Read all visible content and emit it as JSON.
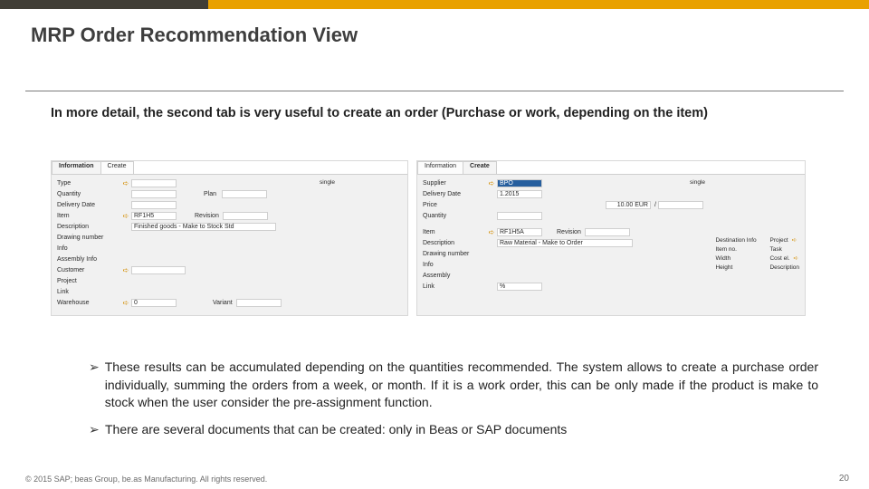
{
  "title": "MRP Order Recommendation View",
  "intro": "In more detail, the second tab is very useful to create an order (Purchase or work, depending on the item)",
  "paneA": {
    "tabs": [
      {
        "label": "Information",
        "active": true
      },
      {
        "label": "Create",
        "active": false
      }
    ],
    "single": "single",
    "rows": [
      {
        "label": "Type",
        "arrow": true,
        "value": ""
      },
      {
        "label": "Quantity",
        "arrow": false,
        "value": "",
        "extra_label": "Plan",
        "extra_value": ""
      },
      {
        "label": "Delivery Date",
        "arrow": false,
        "value": ""
      },
      {
        "label": "Item",
        "arrow": true,
        "value": "RF1H5",
        "extra_label": "Revision",
        "extra_value": ""
      },
      {
        "label": "Description",
        "arrow": false,
        "value": "Finished goods - Make to Stock Std"
      },
      {
        "label": "Drawing number",
        "arrow": false,
        "value": ""
      },
      {
        "label": "Info",
        "arrow": false,
        "value": ""
      },
      {
        "label": "Assembly Info",
        "arrow": false,
        "value": ""
      },
      {
        "label": "Customer",
        "arrow": true,
        "value": ""
      },
      {
        "label": "Project",
        "arrow": false,
        "value": ""
      },
      {
        "label": "Link",
        "arrow": false,
        "value": ""
      },
      {
        "label": "Warehouse",
        "arrow": true,
        "value": "0",
        "extra_label": "Variant",
        "extra_value": ""
      }
    ]
  },
  "paneB": {
    "tabs": [
      {
        "label": "Information",
        "active": false
      },
      {
        "label": "Create",
        "active": true
      }
    ],
    "single": "single",
    "supplier_value": "BPO",
    "rows": [
      {
        "label": "Supplier",
        "value": "BPO",
        "selected": true
      },
      {
        "label": "Delivery Date",
        "value": "1.2015"
      },
      {
        "label": "Price",
        "value": "10.00 EUR",
        "suffix": "/"
      },
      {
        "label": "Quantity",
        "value": ""
      }
    ],
    "rows2": [
      {
        "label": "Item",
        "arrow": true,
        "value": "RF1H5A",
        "extra_label": "Revision",
        "extra_value": ""
      },
      {
        "label": "Description",
        "value": "Raw Material - Make to Order"
      },
      {
        "label": "Drawing number",
        "value": ""
      },
      {
        "label": "Info",
        "value": ""
      },
      {
        "label": "Assembly",
        "value": ""
      },
      {
        "label": "Link",
        "value": "%"
      }
    ],
    "rightblock": [
      {
        "label": "Destination Info",
        "value": "Project",
        "arrow": true
      },
      {
        "label": "Item no.",
        "value": "Task",
        "arrow": false
      },
      {
        "label": "Width",
        "value": "Cost el.",
        "arrow": true
      },
      {
        "label": "Height",
        "value": "Description",
        "arrow": false
      }
    ]
  },
  "bullets": [
    "These results can be accumulated depending on the quantities recommended. The system allows to create a purchase order individually, summing the orders from a week, or month. If it is a work order, this can be only made if the product is make to stock when the user consider the pre-assignment function.",
    "There are several documents that can be created: only in Beas or SAP documents"
  ],
  "footer": {
    "copy": "© 2015 SAP; beas Group, be.as Manufacturing. All rights reserved.",
    "page": "20"
  }
}
